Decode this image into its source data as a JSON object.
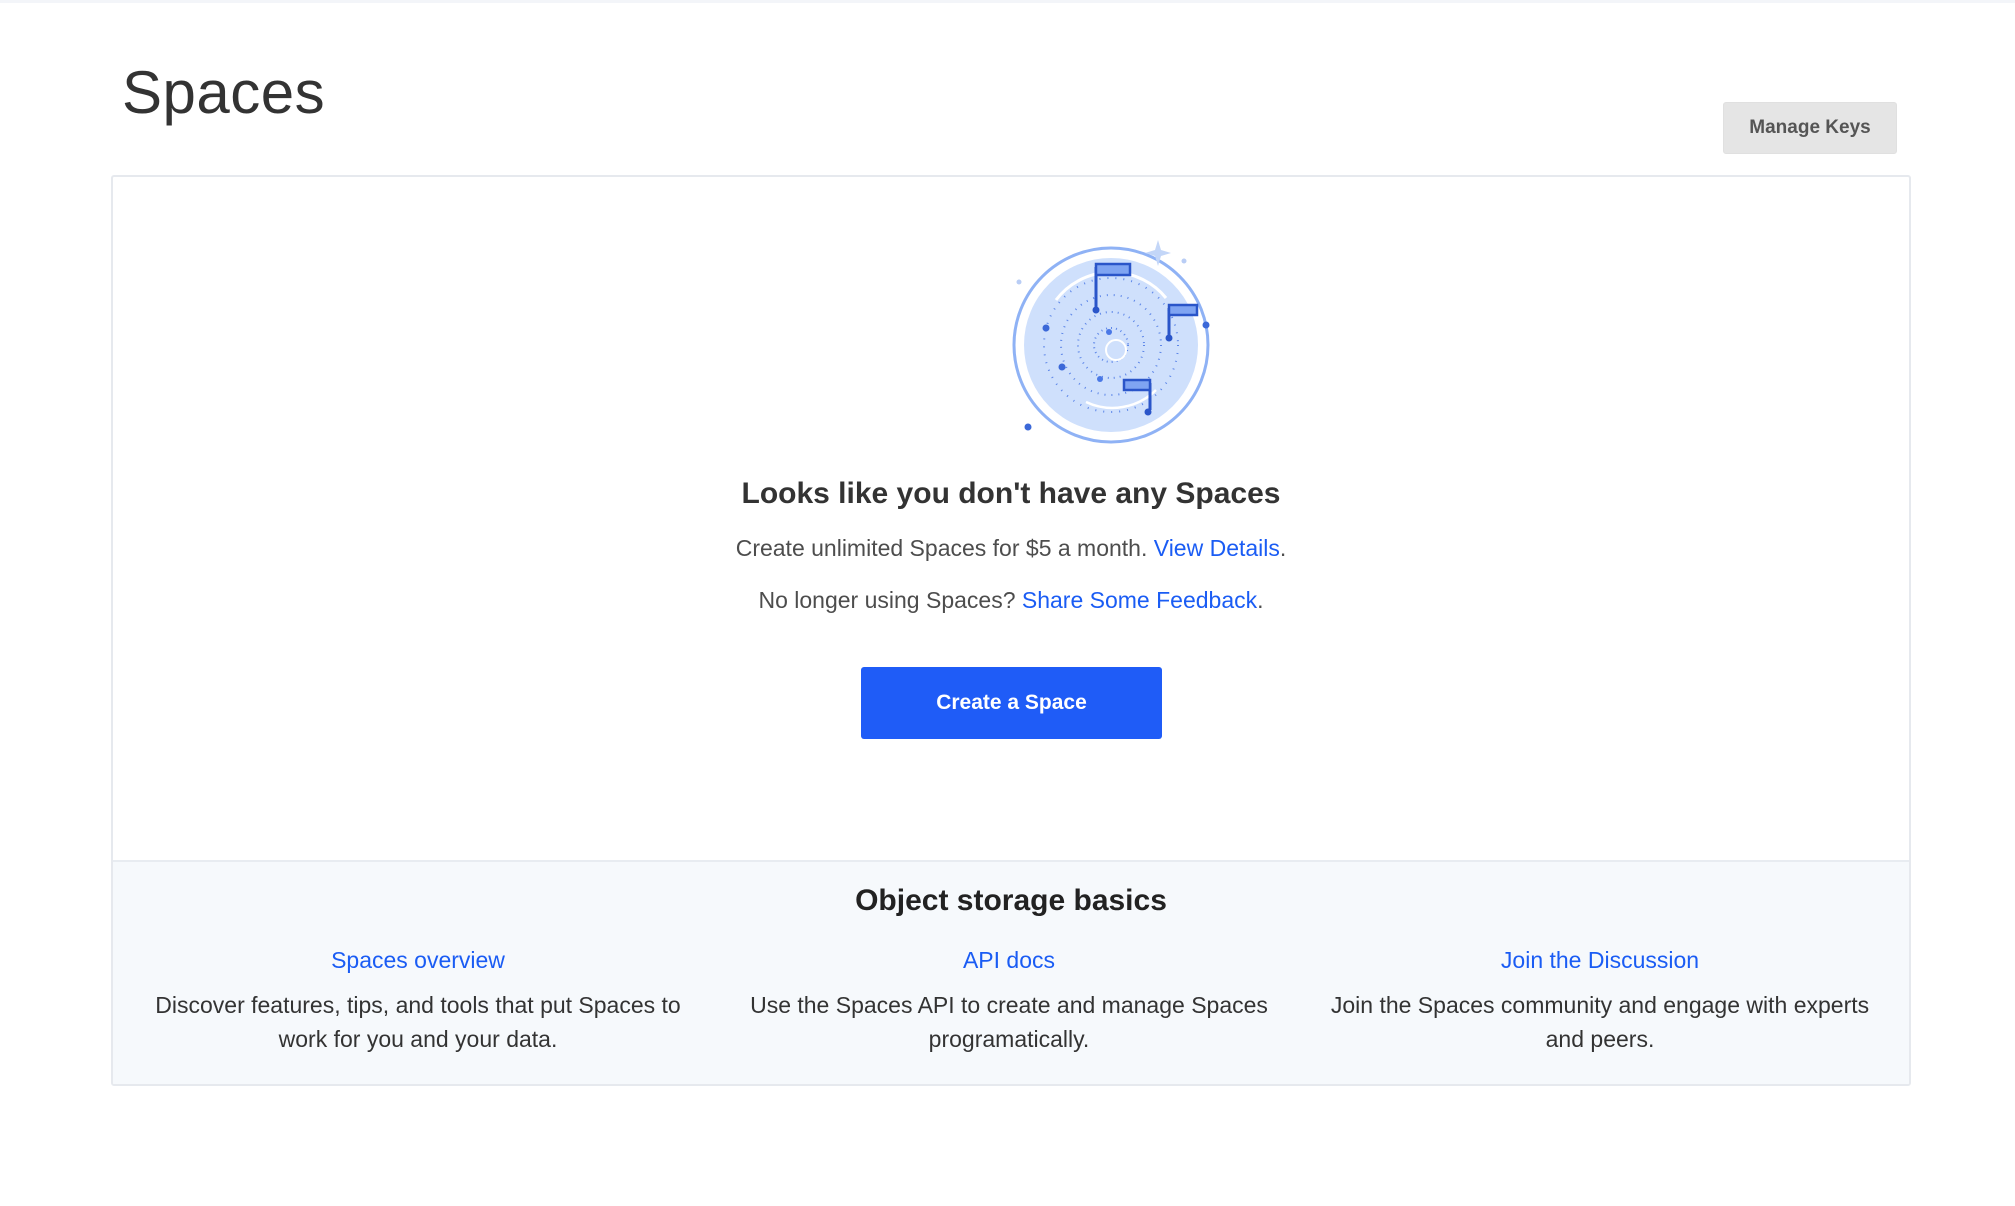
{
  "header": {
    "title": "Spaces",
    "manage_keys_label": "Manage Keys"
  },
  "empty_state": {
    "title": "Looks like you don't have any Spaces",
    "pricing_text": "Create unlimited Spaces for $5 a month.",
    "pricing_link": "View Details",
    "feedback_text": "No longer using Spaces?",
    "feedback_link": "Share Some Feedback",
    "period": ".",
    "create_button_label": "Create a Space",
    "illustration_icon": "spaces-orbit-flags-illustration"
  },
  "basics": {
    "title": "Object storage basics",
    "items": [
      {
        "link": "Spaces overview",
        "description": "Discover features, tips, and tools that put Spaces to work for you and your data."
      },
      {
        "link": "API docs",
        "description": "Use the Spaces API to create and manage Spaces programatically."
      },
      {
        "link": "Join the Discussion",
        "description": "Join the Spaces community and engage with experts and peers."
      }
    ]
  },
  "colors": {
    "primary": "#1f5cf7",
    "link": "#1a5cf4",
    "illustration_fill": "#cfe0fc",
    "illustration_stroke": "#8fb2f5",
    "basics_background": "#f6f9fc"
  }
}
